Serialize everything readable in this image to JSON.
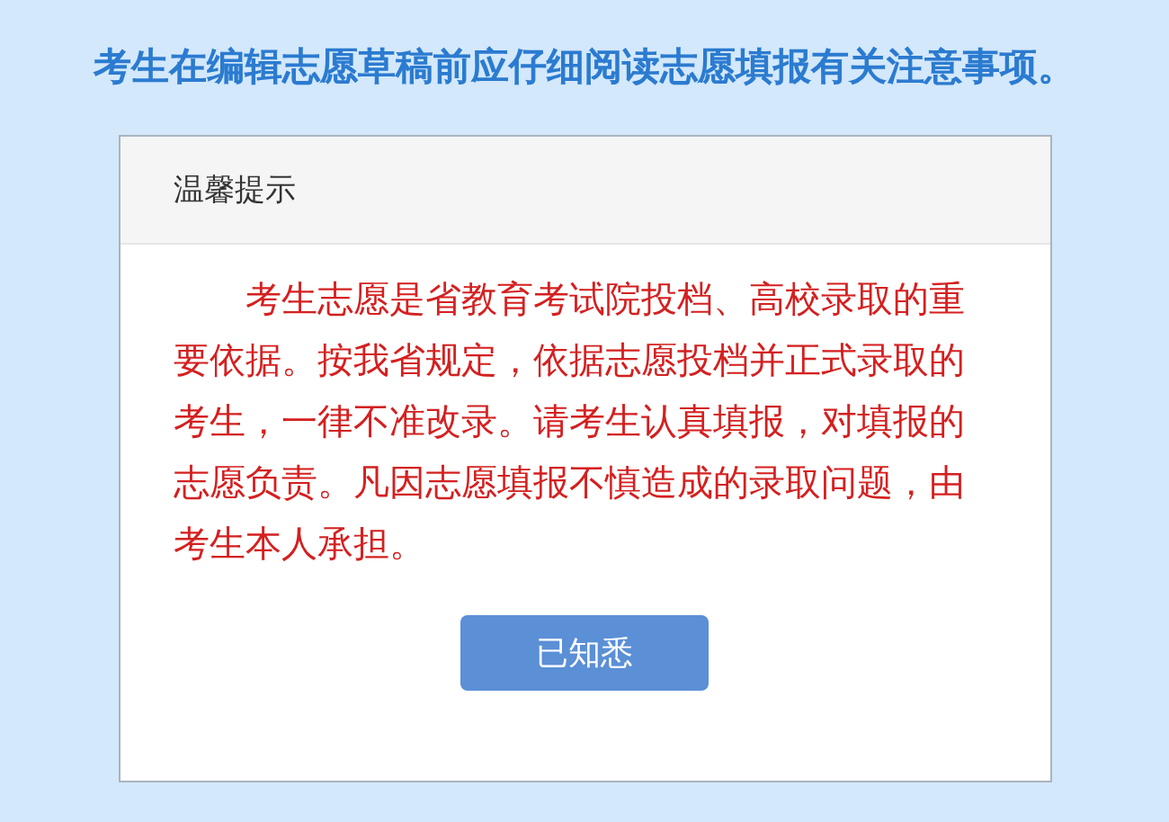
{
  "heading": "考生在编辑志愿草稿前应仔细阅读志愿填报有关注意事项。",
  "dialog": {
    "title": "温馨提示",
    "message": "考生志愿是省教育考试院投档、高校录取的重要依据。按我省规定，依据志愿投档并正式录取的考生，一律不准改录。请考生认真填报，对填报的志愿负责。凡因志愿填报不慎造成的录取问题，由考生本人承担。",
    "button": "已知悉"
  }
}
